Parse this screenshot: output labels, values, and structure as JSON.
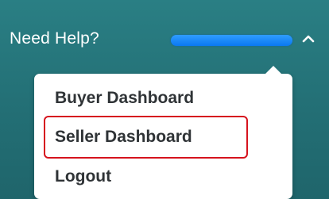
{
  "header": {
    "help_label": "Need Help?",
    "user_name": "",
    "chevron_icon": "chevron-up-icon"
  },
  "menu": {
    "items": [
      {
        "label": "Buyer Dashboard"
      },
      {
        "label": "Seller Dashboard",
        "highlighted": true
      },
      {
        "label": "Logout"
      }
    ]
  },
  "colors": {
    "background": "#236f75",
    "redaction": "#0a78f0",
    "highlight": "#d6131e",
    "menu_text": "#2f3336"
  }
}
